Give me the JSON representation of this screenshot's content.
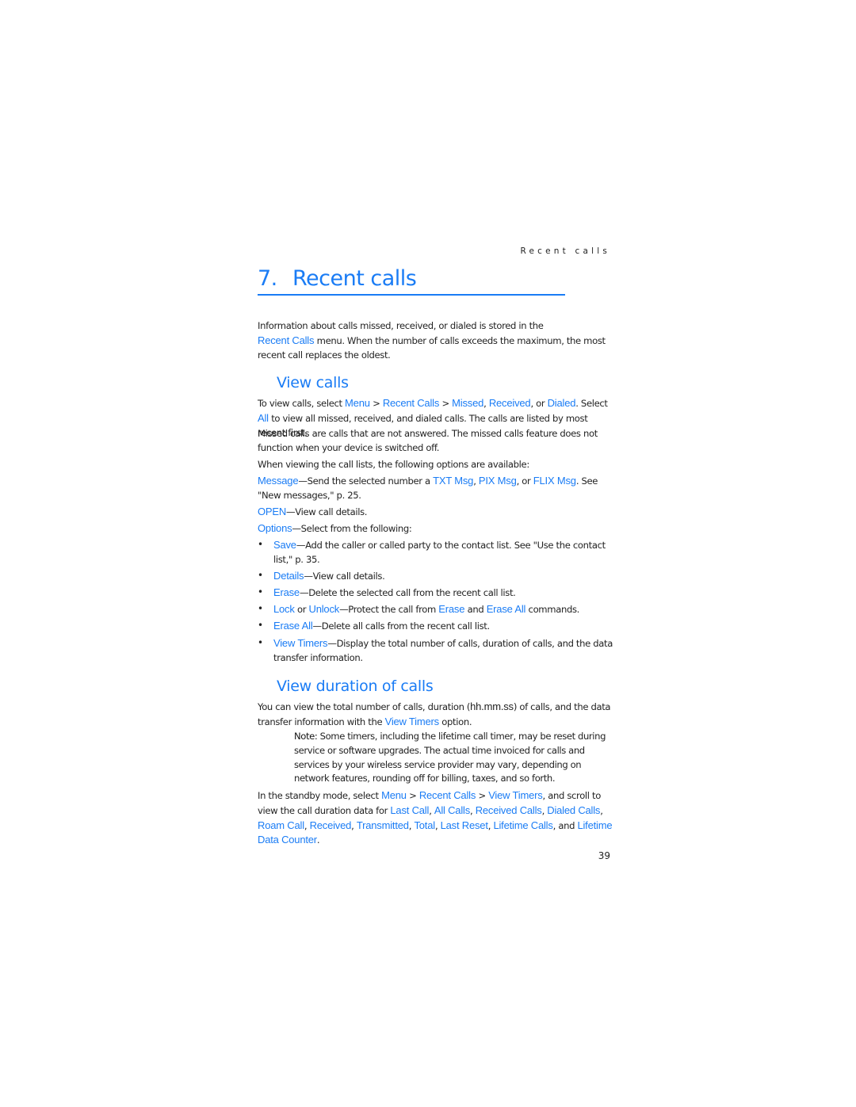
{
  "running_head": "Recent calls",
  "chapter": {
    "number": "7.",
    "title": "Recent calls"
  },
  "intro": {
    "t1": "Information about calls missed, received, or dialed is stored in the",
    "link1": "Recent Calls",
    "t2": " menu. When the number of calls exceeds the maximum, the most recent call replaces the oldest."
  },
  "view_calls": {
    "heading": "View calls",
    "p1": {
      "t1": "To view calls, select ",
      "menu": "Menu",
      "t2": " > ",
      "recent_calls": "Recent Calls",
      "t3": " > ",
      "missed": "Missed",
      "t4": ", ",
      "received": "Received",
      "t5": ", or ",
      "dialed": "Dialed",
      "t6": ". Select ",
      "all": "All",
      "t7": " to view all missed, received, and dialed calls. The calls are listed by most recent first."
    },
    "p2": "Missed calls are calls that are not answered. The missed calls feature does not function when your device is switched off.",
    "p3": "When viewing the call lists, the following options are available:",
    "message": {
      "label": "Message",
      "t1": "—Send the selected number a ",
      "txt": "TXT Msg",
      "t2": ", ",
      "pix": "PIX Msg",
      "t3": ", or ",
      "flix": "FLIX Msg",
      "t4": ". See \"New messages,\" p. 25."
    },
    "open": {
      "label": "OPEN",
      "text": "—View call details."
    },
    "options": {
      "label": "Options",
      "text": "—Select from the following:"
    },
    "bullets": {
      "save": {
        "label": "Save",
        "text": "—Add the caller or called party to the contact list. See \"Use the contact list,\" p. 35."
      },
      "details": {
        "label": "Details",
        "text": "—View call details."
      },
      "erase": {
        "label": "Erase",
        "text": "—Delete the selected call from the recent call list."
      },
      "lock": {
        "label": "Lock",
        "t1": " or ",
        "unlock": "Unlock",
        "t2": "—Protect the call from ",
        "erase": "Erase",
        "t3": " and ",
        "erase_all": "Erase All",
        "t4": " commands."
      },
      "erase_all": {
        "label": "Erase All",
        "text": "—Delete all calls from the recent call list."
      },
      "view_timers": {
        "label": "View Timers",
        "text": "—Display the total number of calls, duration of calls, and the data transfer information."
      }
    },
    "bullet_char": "•"
  },
  "view_duration": {
    "heading": "View duration of calls",
    "p1": {
      "t1": "You can view the total number of calls, duration (",
      "format": "hh.mm.ss",
      "t2": ") of calls, and the data transfer information with the ",
      "view_timers": "View Timers",
      "t3": " option."
    },
    "note": {
      "label": "Note:",
      "text": " Some timers, including the lifetime call timer, may be reset during service or software upgrades. The actual time invoiced for calls and services by your wireless service provider may vary, depending on network features, rounding off for billing, taxes, and so forth."
    },
    "p2": {
      "t1": "In the standby mode, select ",
      "menu": "Menu",
      "t2": " > ",
      "recent_calls": "Recent Calls",
      "t3": " > ",
      "view_timers": "View Timers",
      "t4": ", and scroll to view the call duration data for ",
      "last_call": "Last Call",
      "s1": ", ",
      "all_calls": "All Calls",
      "s2": ", ",
      "received_calls": "Received Calls",
      "s3": ", ",
      "dialed_calls": "Dialed Calls",
      "s4": ", ",
      "roam_call": "Roam Call",
      "s5": ", ",
      "received": "Received",
      "s6": ", ",
      "transmitted": "Transmitted",
      "s7": ", ",
      "total": "Total",
      "s8": ", ",
      "last_reset": "Last Reset",
      "s9": ", ",
      "lifetime_calls": "Lifetime Calls",
      "s10": ", and ",
      "lifetime_data_counter": "Lifetime Data Counter",
      "s11": "."
    }
  },
  "page_number": "39"
}
